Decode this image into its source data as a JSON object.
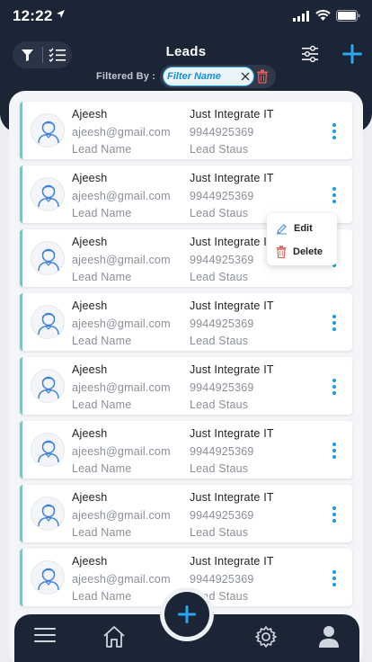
{
  "status_bar": {
    "time": "12:22"
  },
  "header": {
    "title": "Leads",
    "filtered_by_label": "Filtered By :",
    "filter_chip": "Filter Name"
  },
  "leads": [
    {
      "name": "Ajeesh",
      "email": "ajeesh@gmail.com",
      "lead_name": "Lead Name",
      "company": "Just Integrate IT",
      "phone": "9944925369",
      "status": "Lead Staus"
    },
    {
      "name": "Ajeesh",
      "email": "ajeesh@gmail.com",
      "lead_name": "Lead Name",
      "company": "Just Integrate IT",
      "phone": "9944925369",
      "status": "Lead Staus"
    },
    {
      "name": "Ajeesh",
      "email": "ajeesh@gmail.com",
      "lead_name": "Lead Name",
      "company": "Just Integrate IT",
      "phone": "9944925369",
      "status": "Lead Staus"
    },
    {
      "name": "Ajeesh",
      "email": "ajeesh@gmail.com",
      "lead_name": "Lead Name",
      "company": "Just Integrate IT",
      "phone": "9944925369",
      "status": "Lead Staus"
    },
    {
      "name": "Ajeesh",
      "email": "ajeesh@gmail.com",
      "lead_name": "Lead Name",
      "company": "Just Integrate IT",
      "phone": "9944925369",
      "status": "Lead Staus"
    },
    {
      "name": "Ajeesh",
      "email": "ajeesh@gmail.com",
      "lead_name": "Lead Name",
      "company": "Just Integrate IT",
      "phone": "9944925369",
      "status": "Lead Staus"
    },
    {
      "name": "Ajeesh",
      "email": "ajeesh@gmail.com",
      "lead_name": "Lead Name",
      "company": "Just Integrate IT",
      "phone": "9944925369",
      "status": "Lead Staus"
    },
    {
      "name": "Ajeesh",
      "email": "ajeesh@gmail.com",
      "lead_name": "Lead Name",
      "company": "Just Integrate IT",
      "phone": "9944925369",
      "status": "Lead Staus"
    }
  ],
  "context_menu": {
    "edit_label": "Edit",
    "delete_label": "Delete"
  },
  "bottom_nav": [
    "menu-icon",
    "home-icon",
    "add-icon",
    "settings-icon",
    "profile-icon"
  ],
  "colors": {
    "header_bg": "#1c2536",
    "accent": "#1a9ae8",
    "card_border": "#7cc4c0",
    "delete": "#e0605a"
  }
}
